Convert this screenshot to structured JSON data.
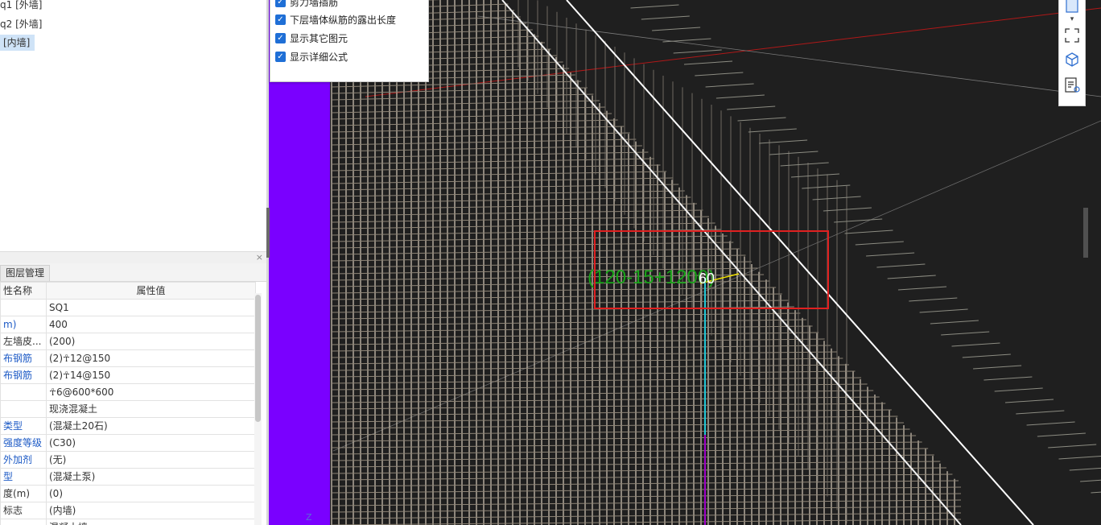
{
  "tree": {
    "items": [
      {
        "label": "q1 [外墙]",
        "selected": false
      },
      {
        "label": "q2 [外墙]",
        "selected": false
      },
      {
        "label": "[内墙]",
        "selected": true
      }
    ]
  },
  "panel": {
    "close_glyph": "×",
    "tab_label": "图层管理"
  },
  "properties": {
    "header_name": "性名称",
    "header_value": "属性值",
    "rows": [
      {
        "name": "",
        "value": "SQ1",
        "blue": false
      },
      {
        "name": "m)",
        "value": "400",
        "blue": true
      },
      {
        "name": "左墙皮...",
        "value": "(200)",
        "blue": false
      },
      {
        "name": "布钢筋",
        "value": "(2)☥12@150",
        "blue": true
      },
      {
        "name": "布钢筋",
        "value": "(2)☥14@150",
        "blue": true
      },
      {
        "name": "",
        "value": "☥6@600*600",
        "blue": false
      },
      {
        "name": "",
        "value": "现浇混凝土",
        "blue": false
      },
      {
        "name": "类型",
        "value": "(混凝土20石)",
        "blue": true
      },
      {
        "name": "强度等级",
        "value": "(C30)",
        "blue": true
      },
      {
        "name": "外加剂",
        "value": "(无)",
        "blue": true
      },
      {
        "name": "型",
        "value": "(混凝土泵)",
        "blue": true
      },
      {
        "name": "度(m)",
        "value": "(0)",
        "blue": false
      },
      {
        "name": "标志",
        "value": "(内墙)",
        "blue": false
      },
      {
        "name": "",
        "value": "混凝土墙",
        "blue": false
      }
    ]
  },
  "options": {
    "items": [
      {
        "label": "剪力墙插筋",
        "checked": true
      },
      {
        "label": "下层墙体纵筋的露出长度",
        "checked": true
      },
      {
        "label": "显示其它图元",
        "checked": true
      },
      {
        "label": "显示详细公式",
        "checked": true
      }
    ],
    "check_glyph": "✓"
  },
  "viewport": {
    "annotation_formula": "(120-15+1200)",
    "annotation_value": "60",
    "axis_label": "Z",
    "colors": {
      "background": "#1f1f1f",
      "rebar": "#c9bfb0",
      "wall_face": "#7a00ff",
      "highlight_box": "#e02020",
      "formula": "#19a319",
      "red_axis": "#b01818",
      "cyan_line": "#22c7d6",
      "magenta_line": "#a000c8",
      "yellow": "#f0e000"
    }
  },
  "toolbar": {
    "icons": [
      "view-cube-icon",
      "dropdown-arrow-icon",
      "fullscreen-icon",
      "3d-box-icon",
      "report-icon"
    ],
    "dropdown_glyph": "▾"
  }
}
